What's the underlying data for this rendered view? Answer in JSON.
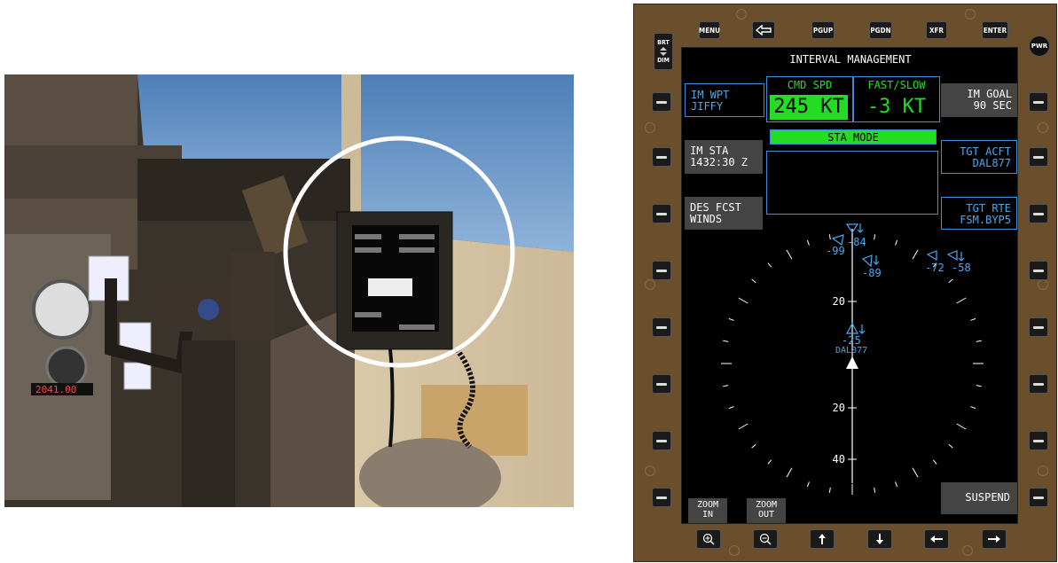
{
  "top_keys": [
    "MENU",
    "PGUP",
    "PGDN",
    "XFR",
    "ENTER"
  ],
  "brt": "BRT",
  "dim": "DIM",
  "pwr": "PWR",
  "photo_clock": "2041.00",
  "screen": {
    "title": "INTERVAL MANAGEMENT",
    "im_wpt": {
      "label": "IM WPT",
      "value": "JIFFY"
    },
    "cmd_spd": {
      "label": "CMD SPD",
      "value": "245 KT"
    },
    "fast_slow": {
      "label": "FAST/SLOW",
      "value": "-3 KT"
    },
    "im_goal": {
      "label": "IM GOAL",
      "value": "90 SEC"
    },
    "sta_mode": "STA MODE",
    "im_sta": {
      "label": "IM STA",
      "value": "1432:30 Z"
    },
    "tgt_acft": {
      "label": "TGT ACFT",
      "value": "DAL877"
    },
    "des_fcst": {
      "label": "DES FCST",
      "value": "WINDS"
    },
    "tgt_rte": {
      "label": "TGT RTE",
      "value": "FSM.BYP5"
    },
    "traffic": [
      {
        "alt": "-99",
        "alt2": "-84"
      },
      {
        "alt": "-89"
      },
      {
        "alt": "-72"
      },
      {
        "alt": "-58"
      },
      {
        "alt": "-25",
        "callsign": "DAL877"
      }
    ],
    "range_labels": [
      "20",
      "20",
      "40"
    ],
    "zoom_in": "ZOOM\nIN",
    "zoom_out": "ZOOM\nOUT",
    "suspend": "SUSPEND"
  },
  "bottom_icons": [
    "zoom-in-icon",
    "zoom-out-icon",
    "arrow-up-icon",
    "arrow-down-icon",
    "arrow-left-icon",
    "arrow-right-icon"
  ],
  "colors": {
    "green": "#22dd22",
    "cyan": "#4aa8f0",
    "bezel": "#6b4e2c"
  }
}
